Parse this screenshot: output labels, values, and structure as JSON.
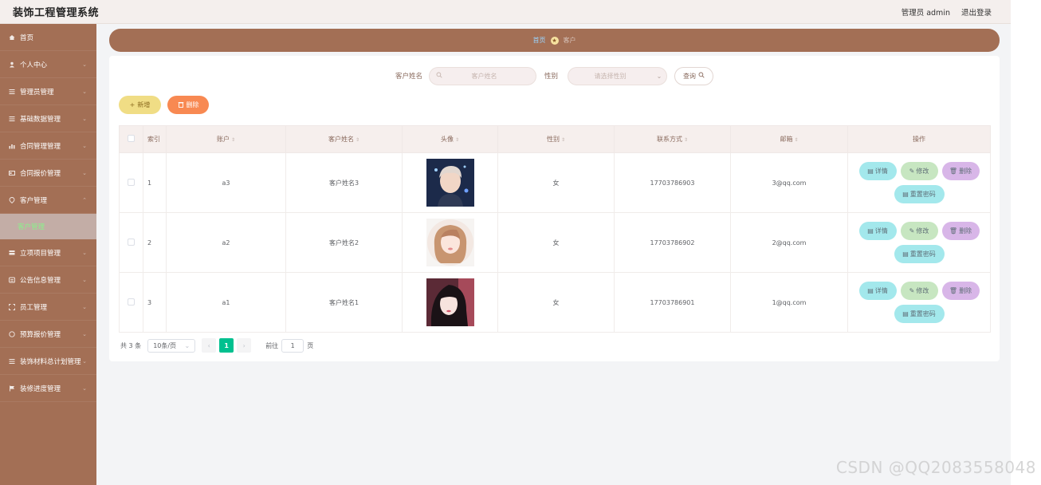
{
  "header": {
    "title": "装饰工程管理系统",
    "user_label": "管理员 admin",
    "logout_label": "退出登录"
  },
  "sidebar": {
    "items": [
      {
        "label": "首页",
        "icon": "home-icon"
      },
      {
        "label": "个人中心",
        "icon": "user-icon"
      },
      {
        "label": "管理员管理",
        "icon": "list-icon"
      },
      {
        "label": "基础数据管理",
        "icon": "list-icon"
      },
      {
        "label": "合同管理管理",
        "icon": "chart-icon"
      },
      {
        "label": "合同报价管理",
        "icon": "card-icon"
      },
      {
        "label": "客户管理",
        "icon": "location-icon"
      },
      {
        "label": "立项项目管理",
        "icon": "stack-icon"
      },
      {
        "label": "公告信息管理",
        "icon": "notice-icon"
      },
      {
        "label": "员工管理",
        "icon": "frame-icon"
      },
      {
        "label": "预算报价管理",
        "icon": "circle-icon"
      },
      {
        "label": "装饰材料总计划管理",
        "icon": "list-icon"
      },
      {
        "label": "装修进度管理",
        "icon": "flag-icon"
      }
    ],
    "active_sub_label": "客户管理"
  },
  "breadcrumb": {
    "home": "首页",
    "current": "客户"
  },
  "search": {
    "name_label": "客户姓名",
    "name_placeholder": "客户姓名",
    "gender_label": "性别",
    "gender_placeholder": "请选择性别",
    "button_label": "查询"
  },
  "actions": {
    "add_label": "新增",
    "delete_label": "删除"
  },
  "table": {
    "headers": {
      "index": "索引",
      "account": "账户",
      "name": "客户姓名",
      "avatar": "头像",
      "gender": "性别",
      "phone": "联系方式",
      "email": "邮箱",
      "ops": "操作"
    },
    "rows": [
      {
        "index": "1",
        "account": "a3",
        "name": "客户姓名3",
        "gender": "女",
        "phone": "17703786903",
        "email": "3@qq.com"
      },
      {
        "index": "2",
        "account": "a2",
        "name": "客户姓名2",
        "gender": "女",
        "phone": "17703786902",
        "email": "2@qq.com"
      },
      {
        "index": "3",
        "account": "a1",
        "name": "客户姓名1",
        "gender": "女",
        "phone": "17703786901",
        "email": "1@qq.com"
      }
    ],
    "op_labels": {
      "detail": "详情",
      "edit": "修改",
      "remove": "删除",
      "reset": "重置密码"
    }
  },
  "pagination": {
    "total": "共 3 条",
    "page_size": "10条/页",
    "current_page": "1",
    "goto_prefix": "前往",
    "goto_value": "1",
    "goto_suffix": "页"
  },
  "watermark": "CSDN @QQ2083558048",
  "colors": {
    "sidebar": "#a36f55",
    "header": "#f4efed",
    "active_page": "#00c08f",
    "add_button": "#f0dd85",
    "delete_button": "#f88952"
  }
}
